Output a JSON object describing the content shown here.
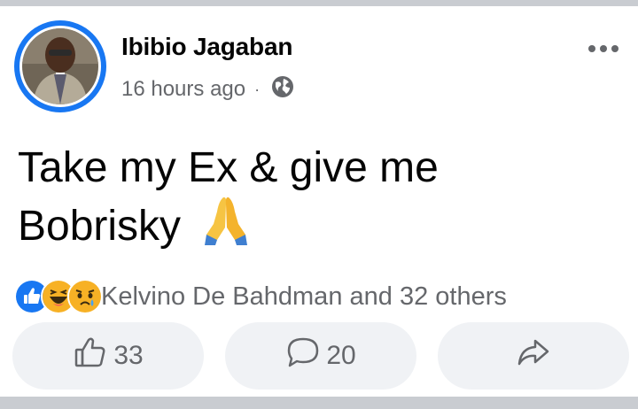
{
  "post": {
    "author": "Ibibio Jagaban",
    "time": "16 hours ago",
    "separator": "·",
    "privacy_icon": "globe-icon",
    "text_line1": "Take my Ex & give me",
    "text_line2": "Bobrisky",
    "emoji": "folded-hands",
    "reactions": [
      "like",
      "haha",
      "sad"
    ],
    "reaction_summary": "Kelvino De Bahdman and 32 others",
    "like_count": "33",
    "comment_count": "20"
  },
  "colors": {
    "accent": "#1877f2",
    "secondary_text": "#65676b",
    "button_bg": "#f0f2f5",
    "page_bg": "#c9ccd1"
  }
}
